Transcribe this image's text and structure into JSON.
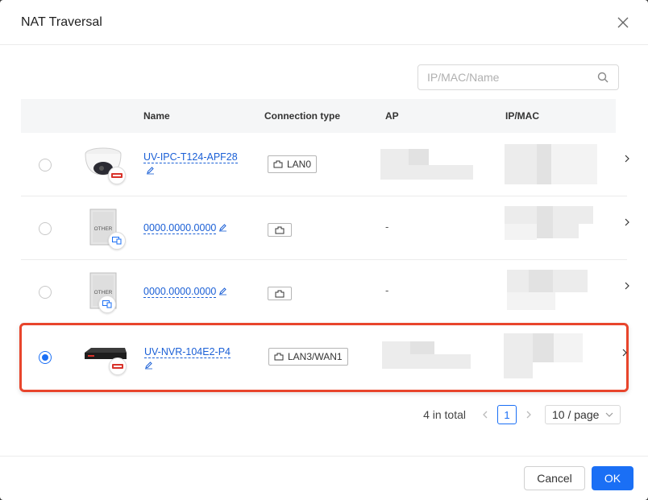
{
  "dialog": {
    "title": "NAT Traversal"
  },
  "search": {
    "placeholder": "IP/MAC/Name"
  },
  "table": {
    "columns": [
      "Name",
      "Connection type",
      "AP",
      "IP/MAC"
    ],
    "rows": [
      {
        "name": "UV-IPC-T124-APF28",
        "connection": "LAN0",
        "ap": "",
        "selected": false,
        "thumb": "dome-camera",
        "badge": "brand-badge"
      },
      {
        "name": "0000.0000.0000",
        "connection": "",
        "ap": "-",
        "selected": false,
        "thumb": "other-device",
        "thumb_label": "OTHER",
        "badge": "monitor-badge"
      },
      {
        "name": "0000.0000.0000",
        "connection": "",
        "ap": "-",
        "selected": false,
        "thumb": "other-device",
        "thumb_label": "OTHER",
        "badge": "monitor-badge"
      },
      {
        "name": "UV-NVR-104E2-P4",
        "connection": "LAN3/WAN1",
        "ap": "",
        "selected": true,
        "thumb": "nvr-device",
        "badge": "brand-badge"
      }
    ]
  },
  "pagination": {
    "total": "4 in total",
    "current_page": "1",
    "page_size": "10 / page"
  },
  "footer": {
    "cancel_label": "Cancel",
    "ok_label": "OK"
  },
  "colors": {
    "primary": "#1a6ff5",
    "link": "#1a5fd6",
    "highlight": "#e8452c"
  }
}
